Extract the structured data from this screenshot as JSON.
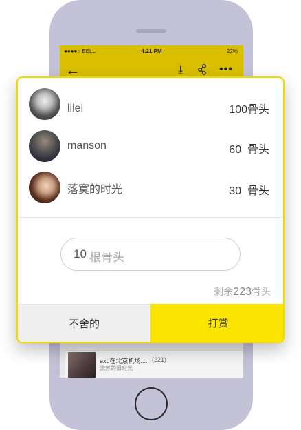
{
  "status_bar": {
    "carrier": "●●●●○ BELL",
    "time": "4:21 PM",
    "battery": "22%"
  },
  "toolbar": {
    "back_icon": "arrow-left-icon",
    "download_icon": "download-icon",
    "share_icon": "share-icon",
    "more_icon": "more-icon"
  },
  "background_item": {
    "title": "exo在北京机场....",
    "count": "(221)",
    "subtitle": "流苏的旧时光"
  },
  "reward_dialog": {
    "rankings": [
      {
        "name": "lilei",
        "amount": "100骨头"
      },
      {
        "name": "manson",
        "amount": "60  骨头"
      },
      {
        "name": "落寞的时光",
        "amount": "30  骨头"
      }
    ],
    "input": {
      "value": "10",
      "unit": "根骨头"
    },
    "remaining": {
      "prefix": "剩余",
      "value": "223",
      "suffix": "骨头"
    },
    "cancel_label": "不舍的",
    "reward_label": "打赏"
  },
  "colors": {
    "accent_yellow": "#fce600",
    "navbar_yellow": "#d9bf00",
    "phone_body": "#c4c2d6"
  }
}
